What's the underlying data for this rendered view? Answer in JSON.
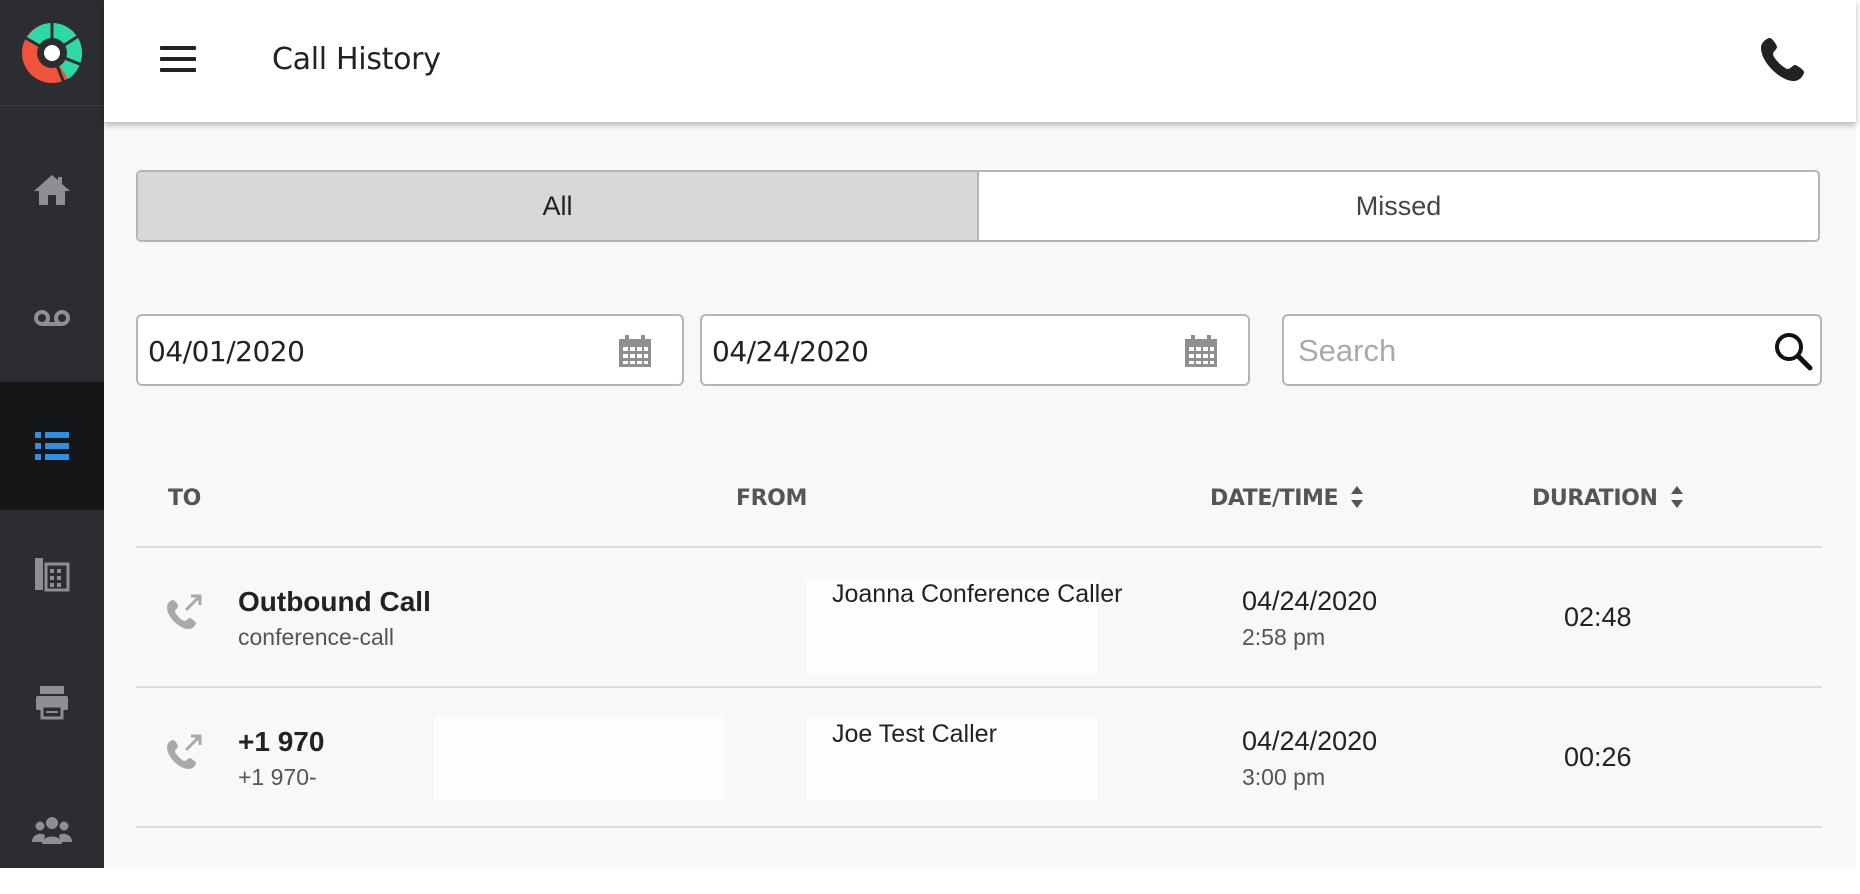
{
  "sidebar": {
    "logo": "logo-icon",
    "items": [
      {
        "icon": "home-icon",
        "active": false
      },
      {
        "icon": "voicemail-icon",
        "active": false
      },
      {
        "icon": "list-icon",
        "active": true
      },
      {
        "icon": "building-icon",
        "active": false
      },
      {
        "icon": "fax-icon",
        "active": false
      },
      {
        "icon": "users-icon",
        "active": false
      }
    ]
  },
  "header": {
    "title": "Call History",
    "menu_icon": "hamburger-icon",
    "action_icon": "phone-icon"
  },
  "tabs": [
    {
      "label": "All",
      "active": true
    },
    {
      "label": "Missed",
      "active": false
    }
  ],
  "filters": {
    "start_date": "04/01/2020",
    "end_date": "04/24/2020",
    "search_placeholder": "Search"
  },
  "table": {
    "columns": {
      "to": "TO",
      "from": "FROM",
      "datetime": "DATE/TIME",
      "duration": "DURATION"
    },
    "rows": [
      {
        "icon": "outbound-call-icon",
        "to_main": "Outbound Call",
        "to_sub": "conference-call",
        "from": "Joanna Conference Caller",
        "date": "04/24/2020",
        "time": "2:58 pm",
        "duration": "02:48"
      },
      {
        "icon": "outbound-call-icon",
        "to_main": "+1 970",
        "to_sub": "+1 970-",
        "from": "Joe Test Caller",
        "date": "04/24/2020",
        "time": "3:00 pm",
        "duration": "00:26"
      }
    ]
  },
  "colors": {
    "sidebar_bg": "#2c2d30",
    "sidebar_active_bg": "#151618",
    "sidebar_icon": "#8e8f93",
    "accent_blue": "#2f8ee6",
    "logo_green": "#2fd9a6",
    "logo_red": "#f0533a"
  }
}
